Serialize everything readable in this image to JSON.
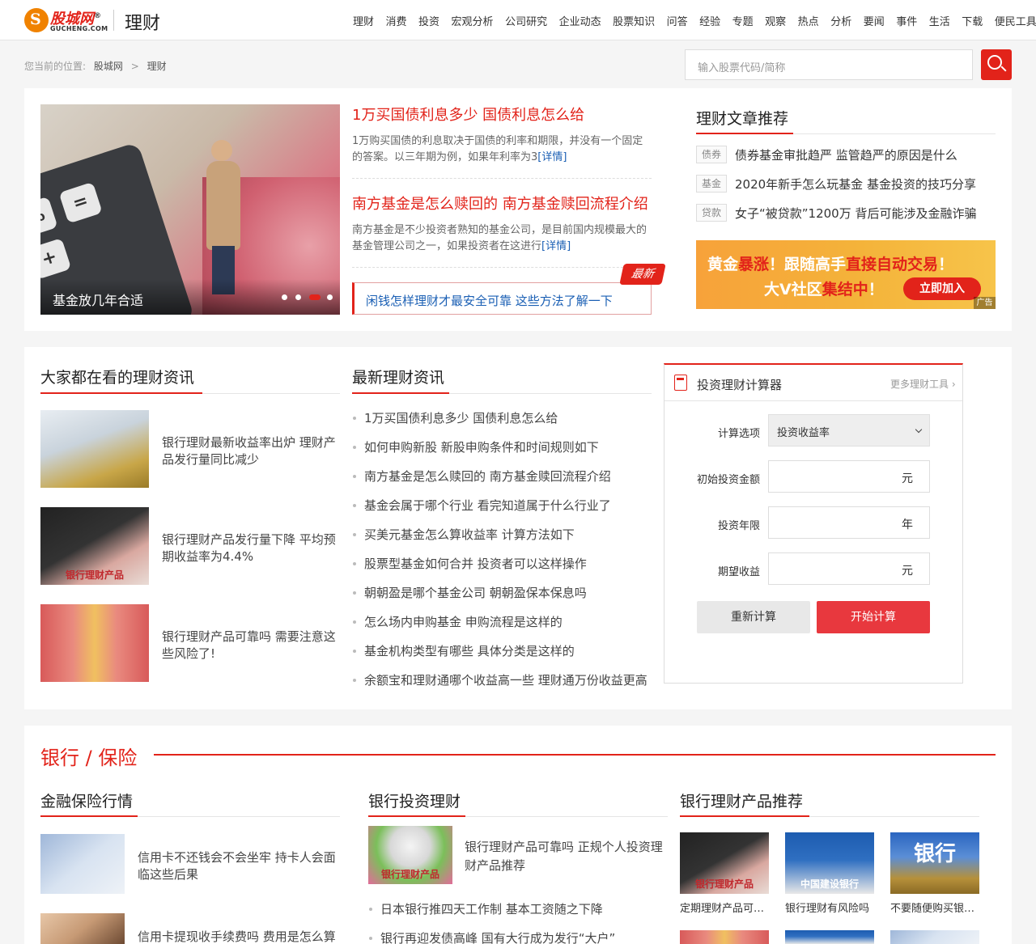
{
  "brand": {
    "name_cn": "股城网",
    "registered": "®",
    "name_en": "GUCHENG.COM",
    "channel": "理财"
  },
  "nav": [
    "理财",
    "消费",
    "投资",
    "宏观分析",
    "公司研究",
    "企业动态",
    "股票知识",
    "问答",
    "经验",
    "专题",
    "观察",
    "热点",
    "分析",
    "要闻",
    "事件",
    "生活",
    "下载",
    "便民工具"
  ],
  "breadcrumb": {
    "label": "您当前的位置:",
    "items": [
      "股城网",
      "理财"
    ],
    "separator": ">"
  },
  "search": {
    "placeholder": "输入股票代码/简称"
  },
  "hero": {
    "caption": "基金放几年合适",
    "slides": 4,
    "active_slide": 3,
    "keys": [
      "%",
      "=",
      "+"
    ]
  },
  "headlines": [
    {
      "title": "1万买国债利息多少 国债利息怎么给",
      "desc": "1万购买国债的利息取决于国债的利率和期限，并没有一个固定的答案。以三年期为例，如果年利率为3",
      "more": "[详情]"
    },
    {
      "title": "南方基金是怎么赎回的 南方基金赎回流程介绍",
      "desc": "南方基金是不少投资者熟知的基金公司，是目前国内规模最大的基金管理公司之一，如果投资者在这进行",
      "more": "[详情]"
    }
  ],
  "hot": {
    "badge": "最新",
    "title": "闲钱怎样理财才最安全可靠 这些方法了解一下"
  },
  "recommend": {
    "title": "理财文章推荐",
    "items": [
      {
        "tag": "债券",
        "title": "债券基金审批趋严 监管趋严的原因是什么"
      },
      {
        "tag": "基金",
        "title": "2020年新手怎么玩基金 基金投资的技巧分享"
      },
      {
        "tag": "贷款",
        "title": "女子“被贷款”1200万 背后可能涉及金融诈骗"
      }
    ]
  },
  "ad": {
    "line1_a": "黄金",
    "line1_b": "暴涨",
    "line1_c": "！跟随高手",
    "line1_d": "直接自动交易",
    "line1_e": "！",
    "line2_a": "大V社区",
    "line2_b": "集结中",
    "line2_c": "！",
    "button": "立即加入",
    "tag": "广告"
  },
  "popular": {
    "title": "大家都在看的理财资讯",
    "items": [
      {
        "title": "银行理财最新收益率出炉 理财产品发行量同比减少"
      },
      {
        "title": "银行理财产品发行量下降 平均预期收益率为4.4%",
        "thumb_text": "银行理财产品"
      },
      {
        "title": "银行理财产品可靠吗 需要注意这些风险了!"
      }
    ]
  },
  "latest": {
    "title": "最新理财资讯",
    "items": [
      "1万买国债利息多少 国债利息怎么给",
      "如何申购新股 新股申购条件和时间规则如下",
      "南方基金是怎么赎回的 南方基金赎回流程介绍",
      "基金会属于哪个行业 看完知道属于什么行业了",
      "买美元基金怎么算收益率 计算方法如下",
      "股票型基金如何合并 投资者可以这样操作",
      "朝朝盈是哪个基金公司 朝朝盈保本保息吗",
      "怎么场内申购基金 申购流程是这样的",
      "基金机构类型有哪些 具体分类是这样的",
      "余额宝和理财通哪个收益高一些 理财通万份收益更高"
    ]
  },
  "calculator": {
    "title": "投资理财计算器",
    "more": "更多理财工具",
    "option_label": "计算选项",
    "option_value": "投资收益率",
    "fields": [
      {
        "label": "初始投资金额",
        "unit": "元"
      },
      {
        "label": "投资年限",
        "unit": "年"
      },
      {
        "label": "期望收益",
        "unit": "元"
      }
    ],
    "reset": "重新计算",
    "submit": "开始计算"
  },
  "bank": {
    "title": "银行 / 保险",
    "insurance": {
      "title": "金融保险行情",
      "items": [
        "信用卡不还钱会不会坐牢 持卡人会面临这些后果",
        "信用卡提现收手续费吗 费用是怎么算的"
      ]
    },
    "invest": {
      "title": "银行投资理财",
      "feature": {
        "title": "银行理财产品可靠吗 正规个人投资理财产品推荐",
        "thumb_text": "银行理财产品"
      },
      "items": [
        "日本银行推四天工作制 基本工资随之下降",
        "银行再迎发债高峰 国有大行成为发行“大户”"
      ]
    },
    "products": {
      "title": "银行理财产品推荐",
      "items": [
        {
          "title": "定期理财产品可靠吗",
          "thumb_text": "银行理财产品"
        },
        {
          "title": "银行理财有风险吗",
          "thumb_text": "中国建设银行"
        },
        {
          "title": "不要随便购买银行理财",
          "thumb_text": "银行"
        }
      ]
    }
  },
  "colors": {
    "brand_red": "#e2231a",
    "link_blue": "#1a5fb4"
  }
}
